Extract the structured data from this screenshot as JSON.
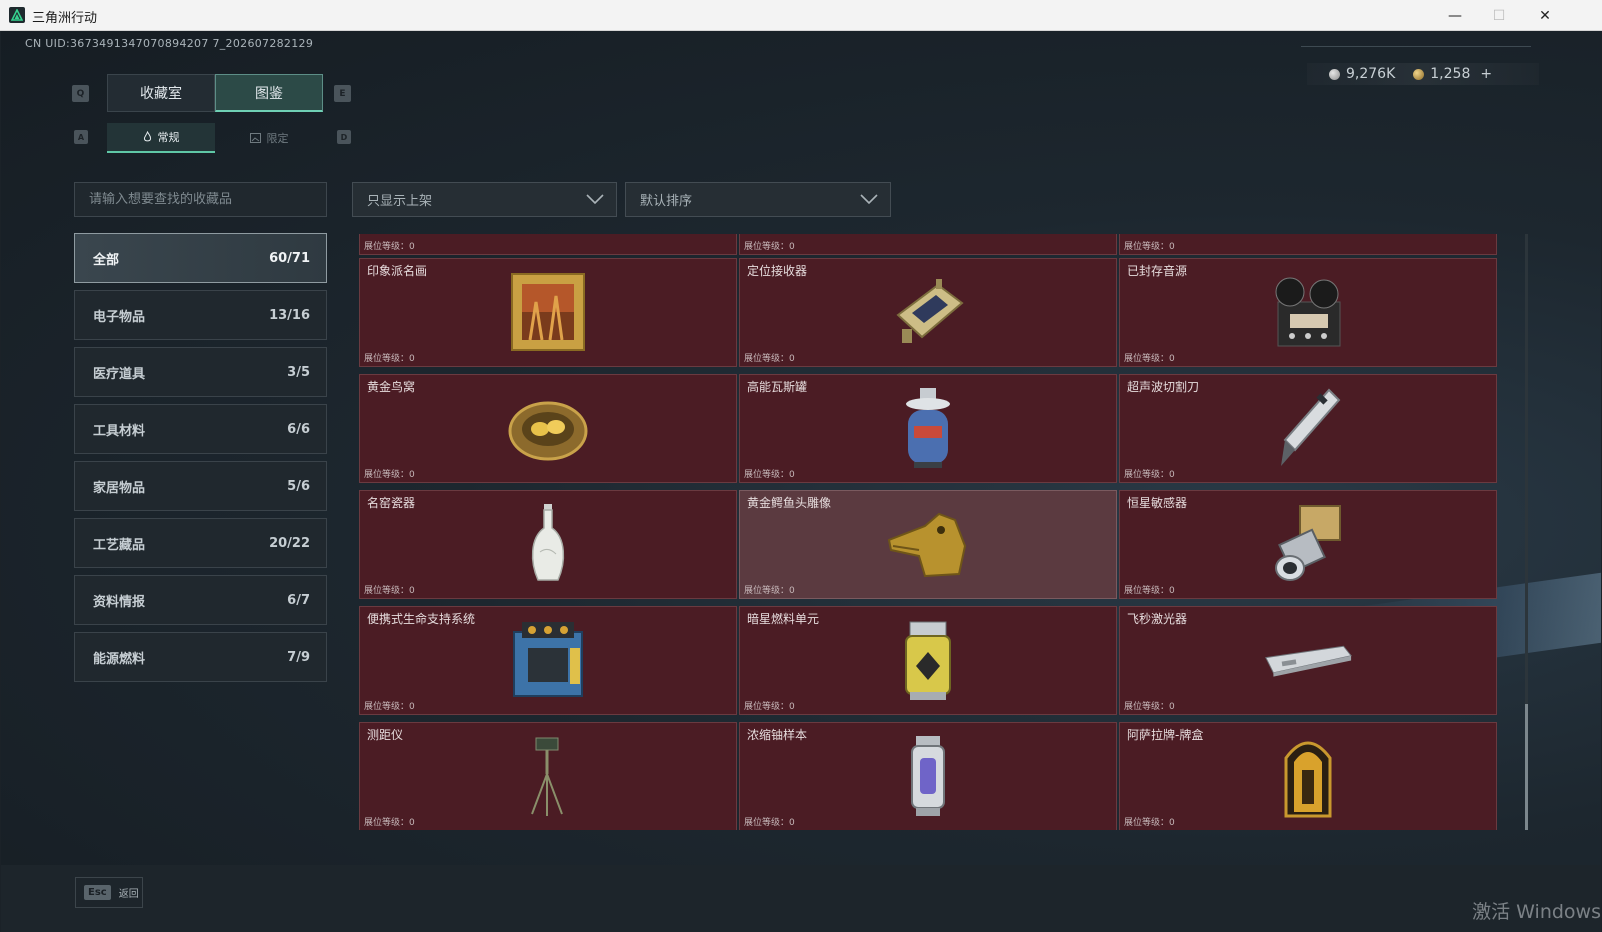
{
  "window": {
    "title": "三角洲行动",
    "minimize": "—",
    "maximize": "☐",
    "close": "✕"
  },
  "header": {
    "uid": "CN UID:3673491347070894207 7_202607282129",
    "currency": [
      {
        "icon": "silver-coin-icon",
        "value": "9,276K"
      },
      {
        "icon": "gold-coin-icon",
        "value": "1,258"
      }
    ],
    "add_label": "+"
  },
  "tabs": {
    "main": [
      {
        "label": "收藏室",
        "key": "Q",
        "active": false
      },
      {
        "label": "图鉴",
        "key": "E",
        "active": true
      }
    ],
    "main_key_left": "Q",
    "main_key_right": "E",
    "sub": [
      {
        "label": "常规",
        "active": true
      },
      {
        "label": "限定",
        "active": false
      }
    ],
    "sub_key_left": "A",
    "sub_key_right": "D"
  },
  "search": {
    "placeholder": "请输入想要查找的收藏品"
  },
  "filters": {
    "shelf": "只显示上架",
    "sort": "默认排序"
  },
  "categories": [
    {
      "label": "全部",
      "count": "60/71",
      "active": true
    },
    {
      "label": "电子物品",
      "count": "13/16"
    },
    {
      "label": "医疗道具",
      "count": "3/5"
    },
    {
      "label": "工具材料",
      "count": "6/6"
    },
    {
      "label": "家居物品",
      "count": "5/6"
    },
    {
      "label": "工艺藏品",
      "count": "20/22"
    },
    {
      "label": "资料情报",
      "count": "6/7"
    },
    {
      "label": "能源燃料",
      "count": "7/9"
    }
  ],
  "level_label": "展位等级：0",
  "items": [
    {
      "name": "",
      "icon": "partial-item-icon"
    },
    {
      "name": "",
      "icon": "partial-item-icon"
    },
    {
      "name": "",
      "icon": "partial-item-icon"
    },
    {
      "name": "印象派名画",
      "icon": "framed-painting-icon"
    },
    {
      "name": "定位接收器",
      "icon": "gps-receiver-icon"
    },
    {
      "name": "已封存音源",
      "icon": "reel-recorder-icon"
    },
    {
      "name": "黄金鸟窝",
      "icon": "golden-nest-icon"
    },
    {
      "name": "高能瓦斯罐",
      "icon": "gas-canister-icon"
    },
    {
      "name": "超声波切割刀",
      "icon": "ultrasonic-cutter-icon"
    },
    {
      "name": "名窑瓷器",
      "icon": "porcelain-vase-icon"
    },
    {
      "name": "黄金鳄鱼头雕像",
      "icon": "golden-crocodile-icon",
      "highlight": true
    },
    {
      "name": "恒星敏感器",
      "icon": "star-sensor-icon"
    },
    {
      "name": "便携式生命支持系统",
      "icon": "life-support-icon"
    },
    {
      "name": "暗星燃料单元",
      "icon": "fuel-cell-icon"
    },
    {
      "name": "飞秒激光器",
      "icon": "femtosecond-laser-icon"
    },
    {
      "name": "测距仪",
      "icon": "rangefinder-tripod-icon"
    },
    {
      "name": "浓缩铀样本",
      "icon": "uranium-sample-icon"
    },
    {
      "name": "阿萨拉牌-牌盒",
      "icon": "card-box-icon"
    }
  ],
  "footer": {
    "esc_key": "Esc",
    "back_label": "返回"
  },
  "watermark": "激活 Windows",
  "colors": {
    "accent": "#5fc7a6",
    "card_bg": "#4b1c24",
    "card_highlight": "#5b3a40"
  }
}
